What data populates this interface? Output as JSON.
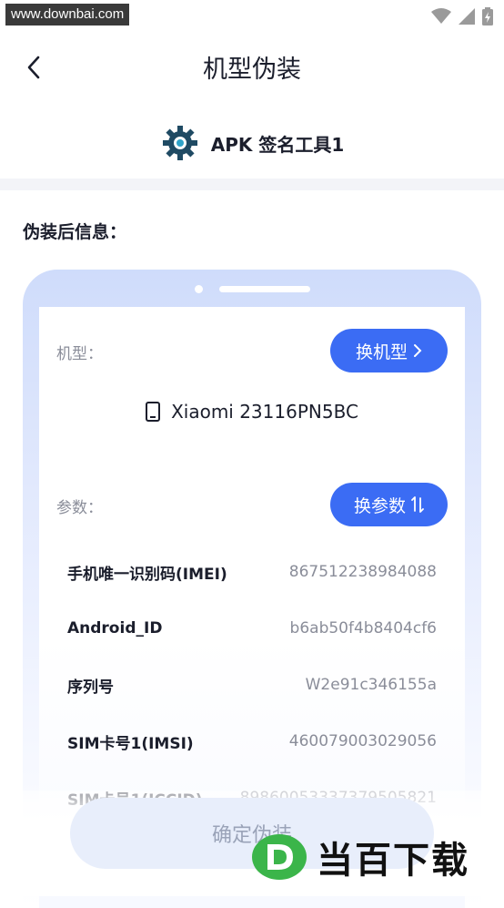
{
  "status_bar": {
    "watermark": "www.downbai.com"
  },
  "header": {
    "title": "机型伪装"
  },
  "app": {
    "name": "APK 签名工具1"
  },
  "section": {
    "title": "伪装后信息："
  },
  "model": {
    "label": "机型：",
    "change_button": "换机型",
    "device_name": "Xiaomi 23116PN5BC"
  },
  "params": {
    "label": "参数：",
    "change_button": "换参数",
    "rows": [
      {
        "key": "手机唯一识别码(IMEI)",
        "value": "867512238984088"
      },
      {
        "key": "Android_ID",
        "value": "b6ab50f4b8404cf6"
      },
      {
        "key": "序列号",
        "value": "W2e91c346155a"
      },
      {
        "key": "SIM卡号1(IMSI)",
        "value": "460079003029056"
      },
      {
        "key": "SIM卡号1(ICCID)",
        "value": "89860053337379505821"
      }
    ]
  },
  "footer": {
    "confirm_button": "确定伪装"
  },
  "logo_watermark": {
    "text": "当百下载"
  },
  "colors": {
    "accent": "#3b6cf4",
    "frame": "#cfdcfb",
    "text": "#1b1e2c",
    "muted": "#8a8d99"
  }
}
